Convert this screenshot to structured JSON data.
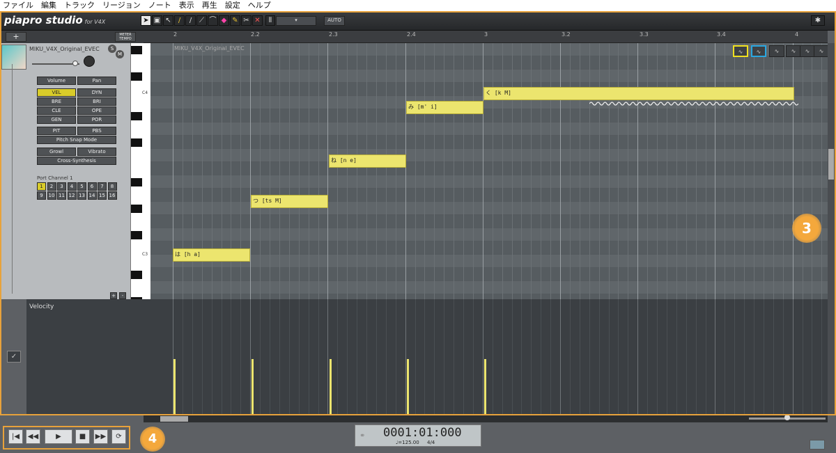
{
  "menu": [
    "ファイル",
    "編集",
    "トラック",
    "リージョン",
    "ノート",
    "表示",
    "再生",
    "設定",
    "ヘルプ"
  ],
  "app": {
    "logo": "piapro studio",
    "logo_sub": "for V4X"
  },
  "toolbar": {
    "auto_label": "AUTO",
    "add_label": "+",
    "meter_tempo": "METER TEMPO"
  },
  "track": {
    "name": "MIKU_V4X_Original_EVEC",
    "solo": "S",
    "mute": "M",
    "buttons": [
      "Volume",
      "Pan",
      "VEL",
      "DYN",
      "BRE",
      "BRI",
      "CLE",
      "OPE",
      "GEN",
      "POR",
      "PIT",
      "PBS",
      "Pitch Snap Mode",
      "Growl",
      "Vibrato",
      "Cross-Synthesis"
    ],
    "port_label": "Port Channel 1",
    "channels": [
      "1",
      "2",
      "3",
      "4",
      "5",
      "6",
      "7",
      "8",
      "9",
      "10",
      "11",
      "12",
      "13",
      "14",
      "15",
      "16"
    ]
  },
  "ruler": {
    "marks": [
      "2",
      "2.2",
      "2.3",
      "2.4",
      "3",
      "3.2",
      "3.3",
      "3.4",
      "4"
    ]
  },
  "keys": {
    "c4": "C4",
    "c3": "C3"
  },
  "region_label": "MIKU_V4X_Original_EVEC",
  "notes": [
    {
      "lyric": "は",
      "phoneme": "[h a]"
    },
    {
      "lyric": "つ",
      "phoneme": "[ts M]"
    },
    {
      "lyric": "ね",
      "phoneme": "[n e]"
    },
    {
      "lyric": "み",
      "phoneme": "[m' i]"
    },
    {
      "lyric": "く",
      "phoneme": "[k M]"
    }
  ],
  "velocity": {
    "label": "Velocity"
  },
  "transport": {
    "time": "0001:01:000",
    "tempo": "♩=125.00",
    "signature": "4/4"
  },
  "callouts": {
    "c3": "3",
    "c4": "4"
  },
  "colors": {
    "accent": "#e8a23b",
    "note": "#ece56e",
    "yellow_box": "#f0e020",
    "blue_box": "#2aa7e0"
  }
}
